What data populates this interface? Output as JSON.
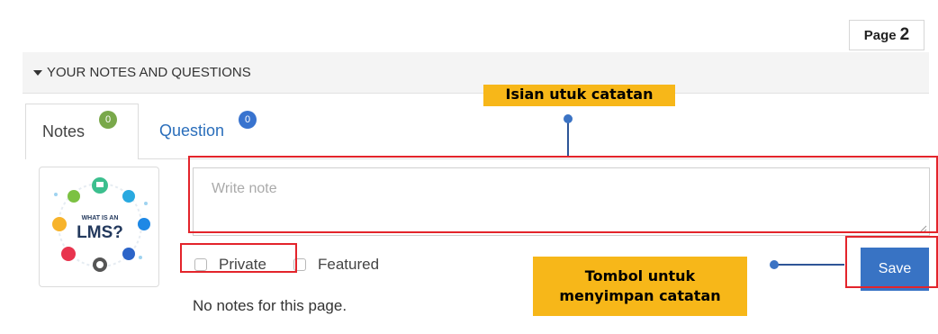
{
  "page_indicator": {
    "label": "Page",
    "number": "2"
  },
  "section": {
    "title": "YOUR NOTES AND QUESTIONS"
  },
  "tabs": [
    {
      "label": "Notes",
      "count": "0",
      "active": true
    },
    {
      "label": "Question",
      "count": "0",
      "active": false
    }
  ],
  "thumbnail": {
    "line1": "WHAT IS AN",
    "line2": "LMS?"
  },
  "note_input": {
    "placeholder": "Write note"
  },
  "options": {
    "private_label": "Private",
    "featured_label": "Featured"
  },
  "save_button": {
    "label": "Save"
  },
  "empty_message": "No notes for this page.",
  "annotations": {
    "input_callout": "Isian utuk catatan",
    "save_callout_line1": "Tombol untuk",
    "save_callout_line2": "menyimpan catatan"
  },
  "colors": {
    "accent": "#3873c4",
    "callout_bg": "#f7b719",
    "highlight": "#e3242b",
    "badge_green": "#79a84a"
  }
}
